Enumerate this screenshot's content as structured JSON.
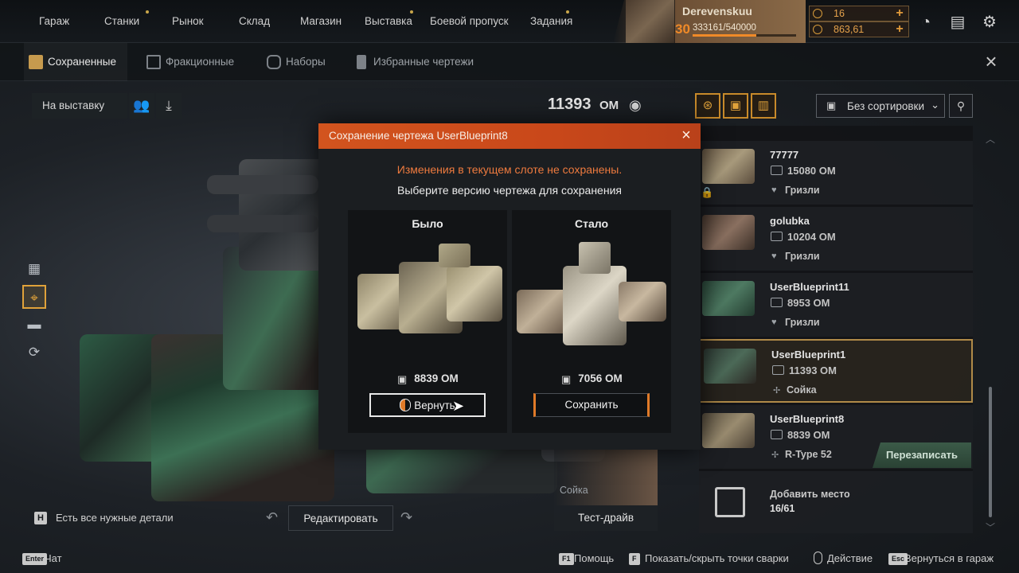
{
  "nav": {
    "items": [
      "Гараж",
      "Станки",
      "Рынок",
      "Склад",
      "Магазин",
      "Выставка",
      "Боевой пропуск",
      "Задания"
    ],
    "dot_items": [
      1,
      5,
      7
    ]
  },
  "player": {
    "name": "Derevenskuu",
    "level": "30",
    "xp": "333161/540000",
    "xp_progress": 0.617
  },
  "currency": {
    "coins": "16",
    "badges": "863,61"
  },
  "top_icons": [
    "speedometer-icon",
    "chat-icon",
    "gear-icon"
  ],
  "tabs": [
    {
      "label": "Сохраненные",
      "icon": "blueprint-folder-icon",
      "active": true
    },
    {
      "label": "Фракционные",
      "icon": "faction-icon",
      "active": false
    },
    {
      "label": "Наборы",
      "icon": "kit-icon",
      "active": false
    },
    {
      "label": "Избранные чертежи",
      "icon": "bookmark-icon",
      "active": false
    }
  ],
  "left_panel": {
    "exhibit_label": "На выставку"
  },
  "center": {
    "om_value": "11393",
    "om_unit": "ОМ"
  },
  "sort": {
    "label": "Без сортировки"
  },
  "blueprints": [
    {
      "name": "77777",
      "om": "15080 ОМ",
      "cabin": "Гризли",
      "locked": true
    },
    {
      "name": "golubka",
      "om": "10204 ОМ",
      "cabin": "Гризли"
    },
    {
      "name": "UserBlueprint11",
      "om": "8953 ОМ",
      "cabin": "Гризли"
    },
    {
      "name": "UserBlueprint1",
      "om": "11393 ОМ",
      "cabin": "Сойка",
      "selected": true
    },
    {
      "name": "UserBlueprint8",
      "om": "8839 ОМ",
      "cabin": "R-Type 52",
      "overwrite": "Перезаписать"
    }
  ],
  "add_slot": {
    "label": "Добавить место",
    "count": "16/61"
  },
  "bottom": {
    "h_key": "H",
    "parts_text": "Есть все нужные детали",
    "edit_label": "Редактировать",
    "pilot_name": "Сойка",
    "test_drive_label": "Тест-драйв"
  },
  "footer": [
    {
      "key": "Enter",
      "label": "Чат"
    },
    {
      "key": "F1",
      "label": "Помощь"
    },
    {
      "key": "F",
      "label": "Показать/скрыть точки сварки"
    },
    {
      "key": "mouse",
      "label": "Действие"
    },
    {
      "key": "Esc",
      "label": "Вернуться в гараж"
    }
  ],
  "modal": {
    "title": "Сохранение чертежа UserBlueprint8",
    "warning": "Изменения в текущем слоте не сохранены.",
    "subtitle": "Выберите версию чертежа для сохранения",
    "before": {
      "title": "Было",
      "om": "8839 ОМ",
      "button": "Вернуть"
    },
    "after": {
      "title": "Стало",
      "om": "7056 ОМ",
      "button": "Сохранить"
    }
  },
  "colors": {
    "accent": "#e0a23a",
    "modal_header": "#d2541e",
    "warning": "#ee7a3e"
  }
}
